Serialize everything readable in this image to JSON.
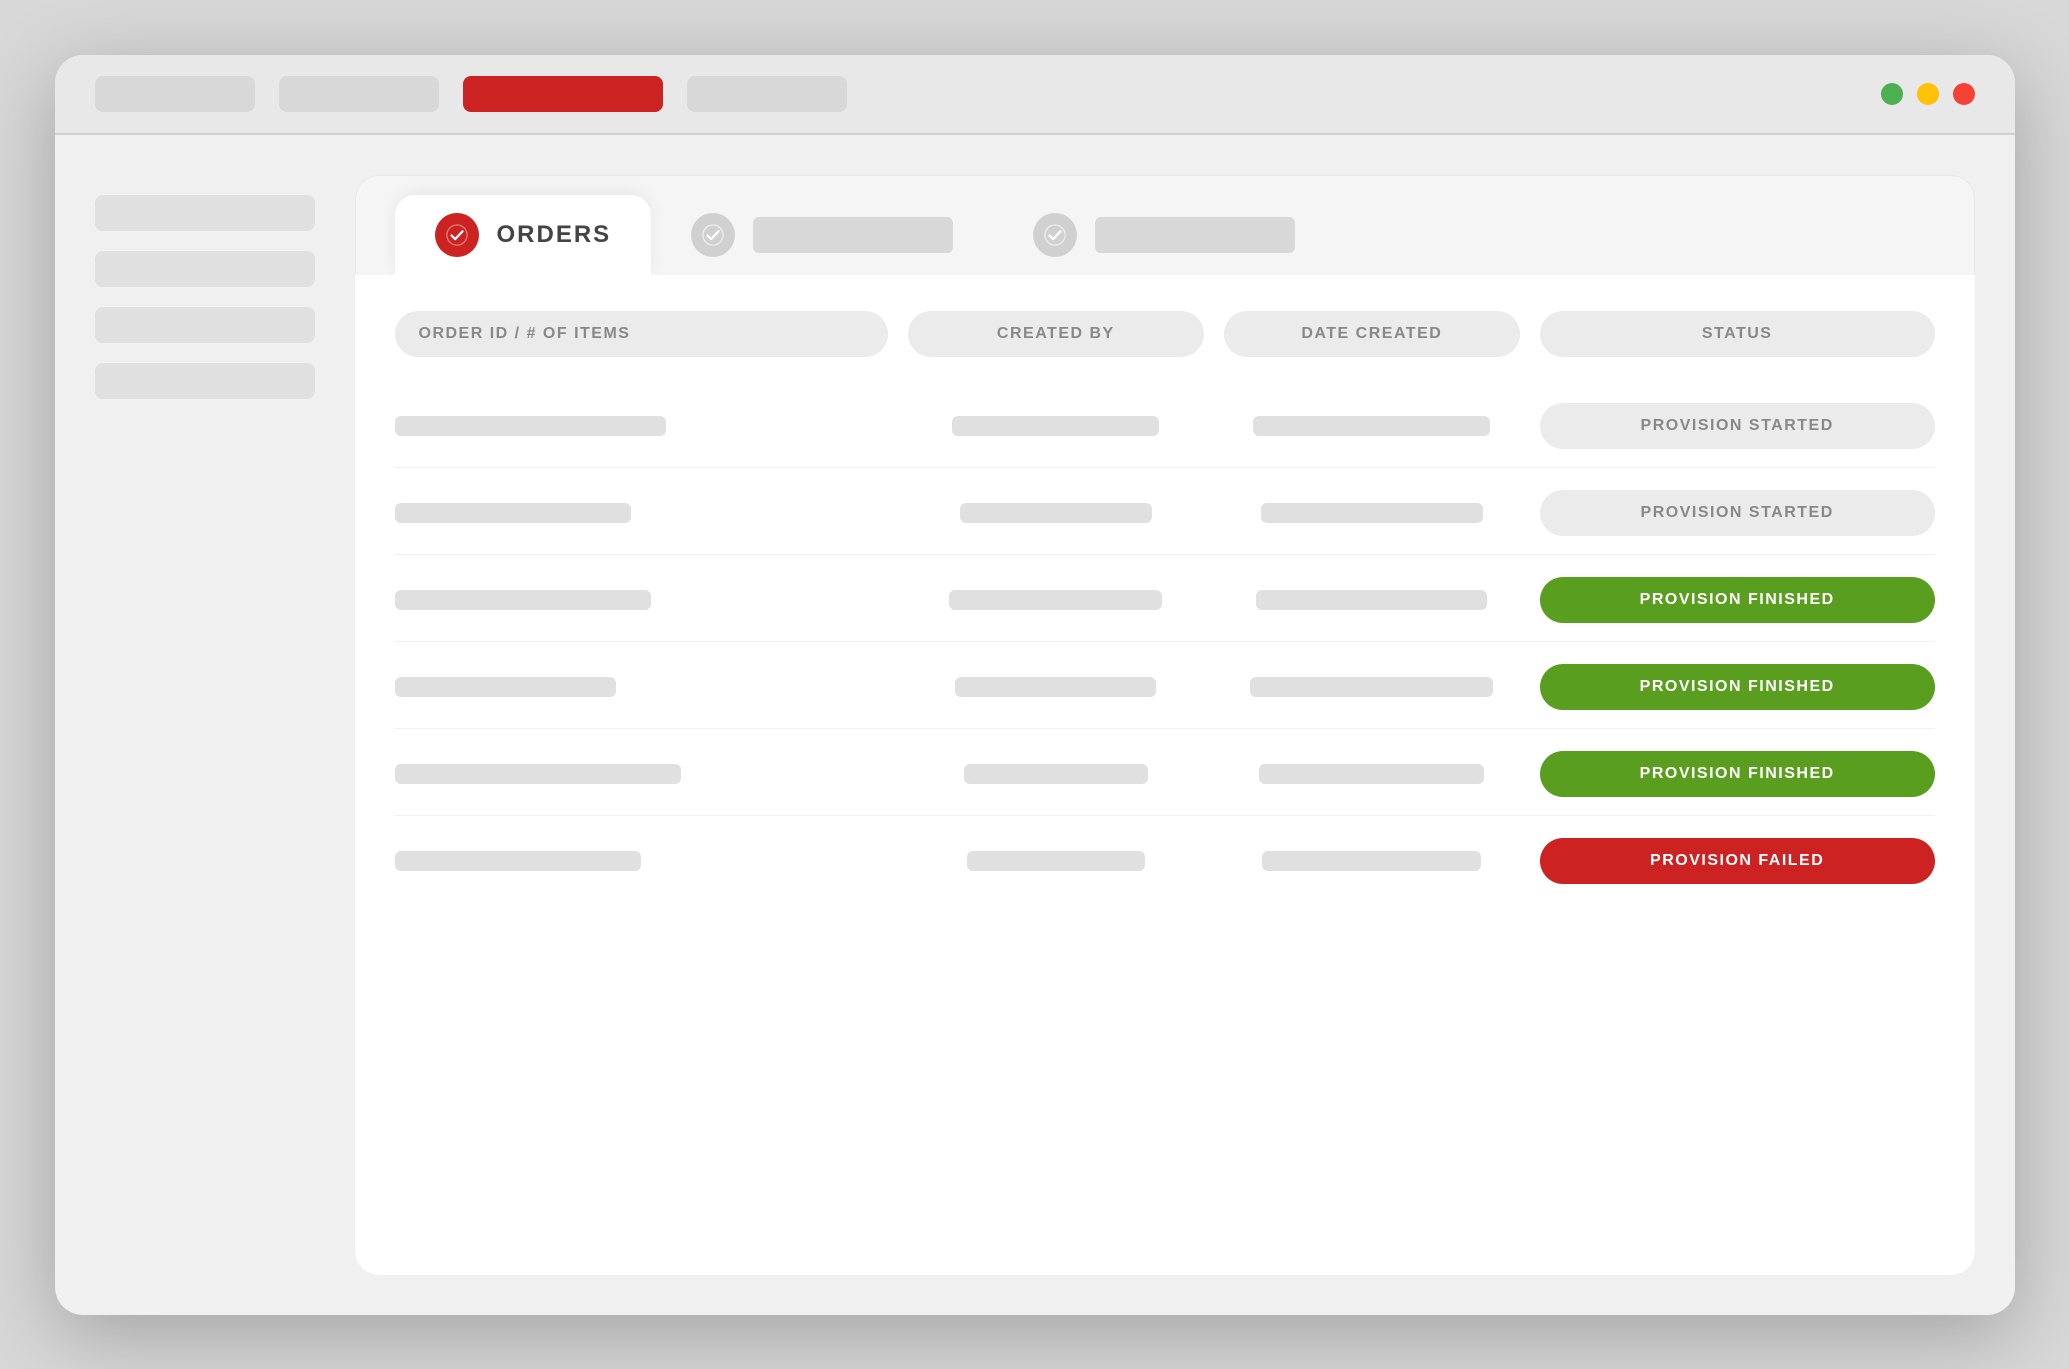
{
  "browser": {
    "tabs": [
      {
        "label": "",
        "active": true
      },
      {
        "label": "",
        "active": false
      },
      {
        "label": "",
        "active": false
      },
      {
        "label": "",
        "active": false
      }
    ],
    "controls": {
      "green": "#4CAF50",
      "yellow": "#FFC107",
      "red": "#F44336"
    }
  },
  "sidebar": {
    "items": [
      "",
      "",
      "",
      ""
    ]
  },
  "nav_tabs": [
    {
      "label": "ORDERS",
      "icon": "check",
      "active": true
    },
    {
      "label": "",
      "icon": "check-gray",
      "active": false
    },
    {
      "label": "",
      "icon": "check-gray",
      "active": false
    }
  ],
  "table": {
    "columns": [
      {
        "label": "ORDER ID / # OF ITEMS"
      },
      {
        "label": "CREATED BY"
      },
      {
        "label": "DATE CREATED"
      },
      {
        "label": "STATUS"
      }
    ],
    "rows": [
      {
        "status": "PROVISION STARTED",
        "status_type": "started"
      },
      {
        "status": "PROVISION STARTED",
        "status_type": "started"
      },
      {
        "status": "PROVISION FINISHED",
        "status_type": "finished"
      },
      {
        "status": "PROVISION FINISHED",
        "status_type": "finished"
      },
      {
        "status": "PROVISION FINISHED",
        "status_type": "finished"
      },
      {
        "status": "PROVISION FAILED",
        "status_type": "failed"
      }
    ]
  }
}
